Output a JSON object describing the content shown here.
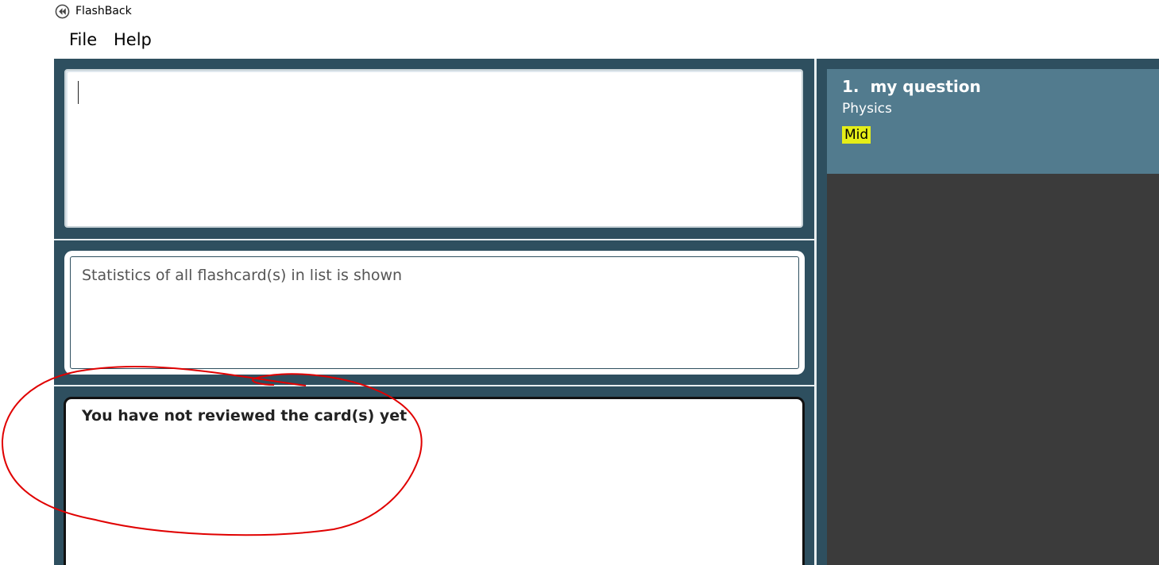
{
  "window": {
    "title": "FlashBack",
    "icon": "rewind-icon"
  },
  "menu": {
    "items": [
      "File",
      "Help"
    ]
  },
  "command_box": {
    "value": ""
  },
  "result_display": {
    "text": "Statistics of all flashcard(s) in list is shown"
  },
  "review_panel": {
    "text": "You have not reviewed the card(s) yet"
  },
  "flashcard_list": {
    "cards": [
      {
        "index": "1.",
        "question": "my question",
        "category": "Physics",
        "tag": "Mid"
      }
    ]
  },
  "colors": {
    "background_dark": "#2e4f5f",
    "card_bg": "#527b8e",
    "list_bg": "#3b3b3b",
    "tag_bg": "#e5ee18",
    "annotation": "#e00000"
  }
}
